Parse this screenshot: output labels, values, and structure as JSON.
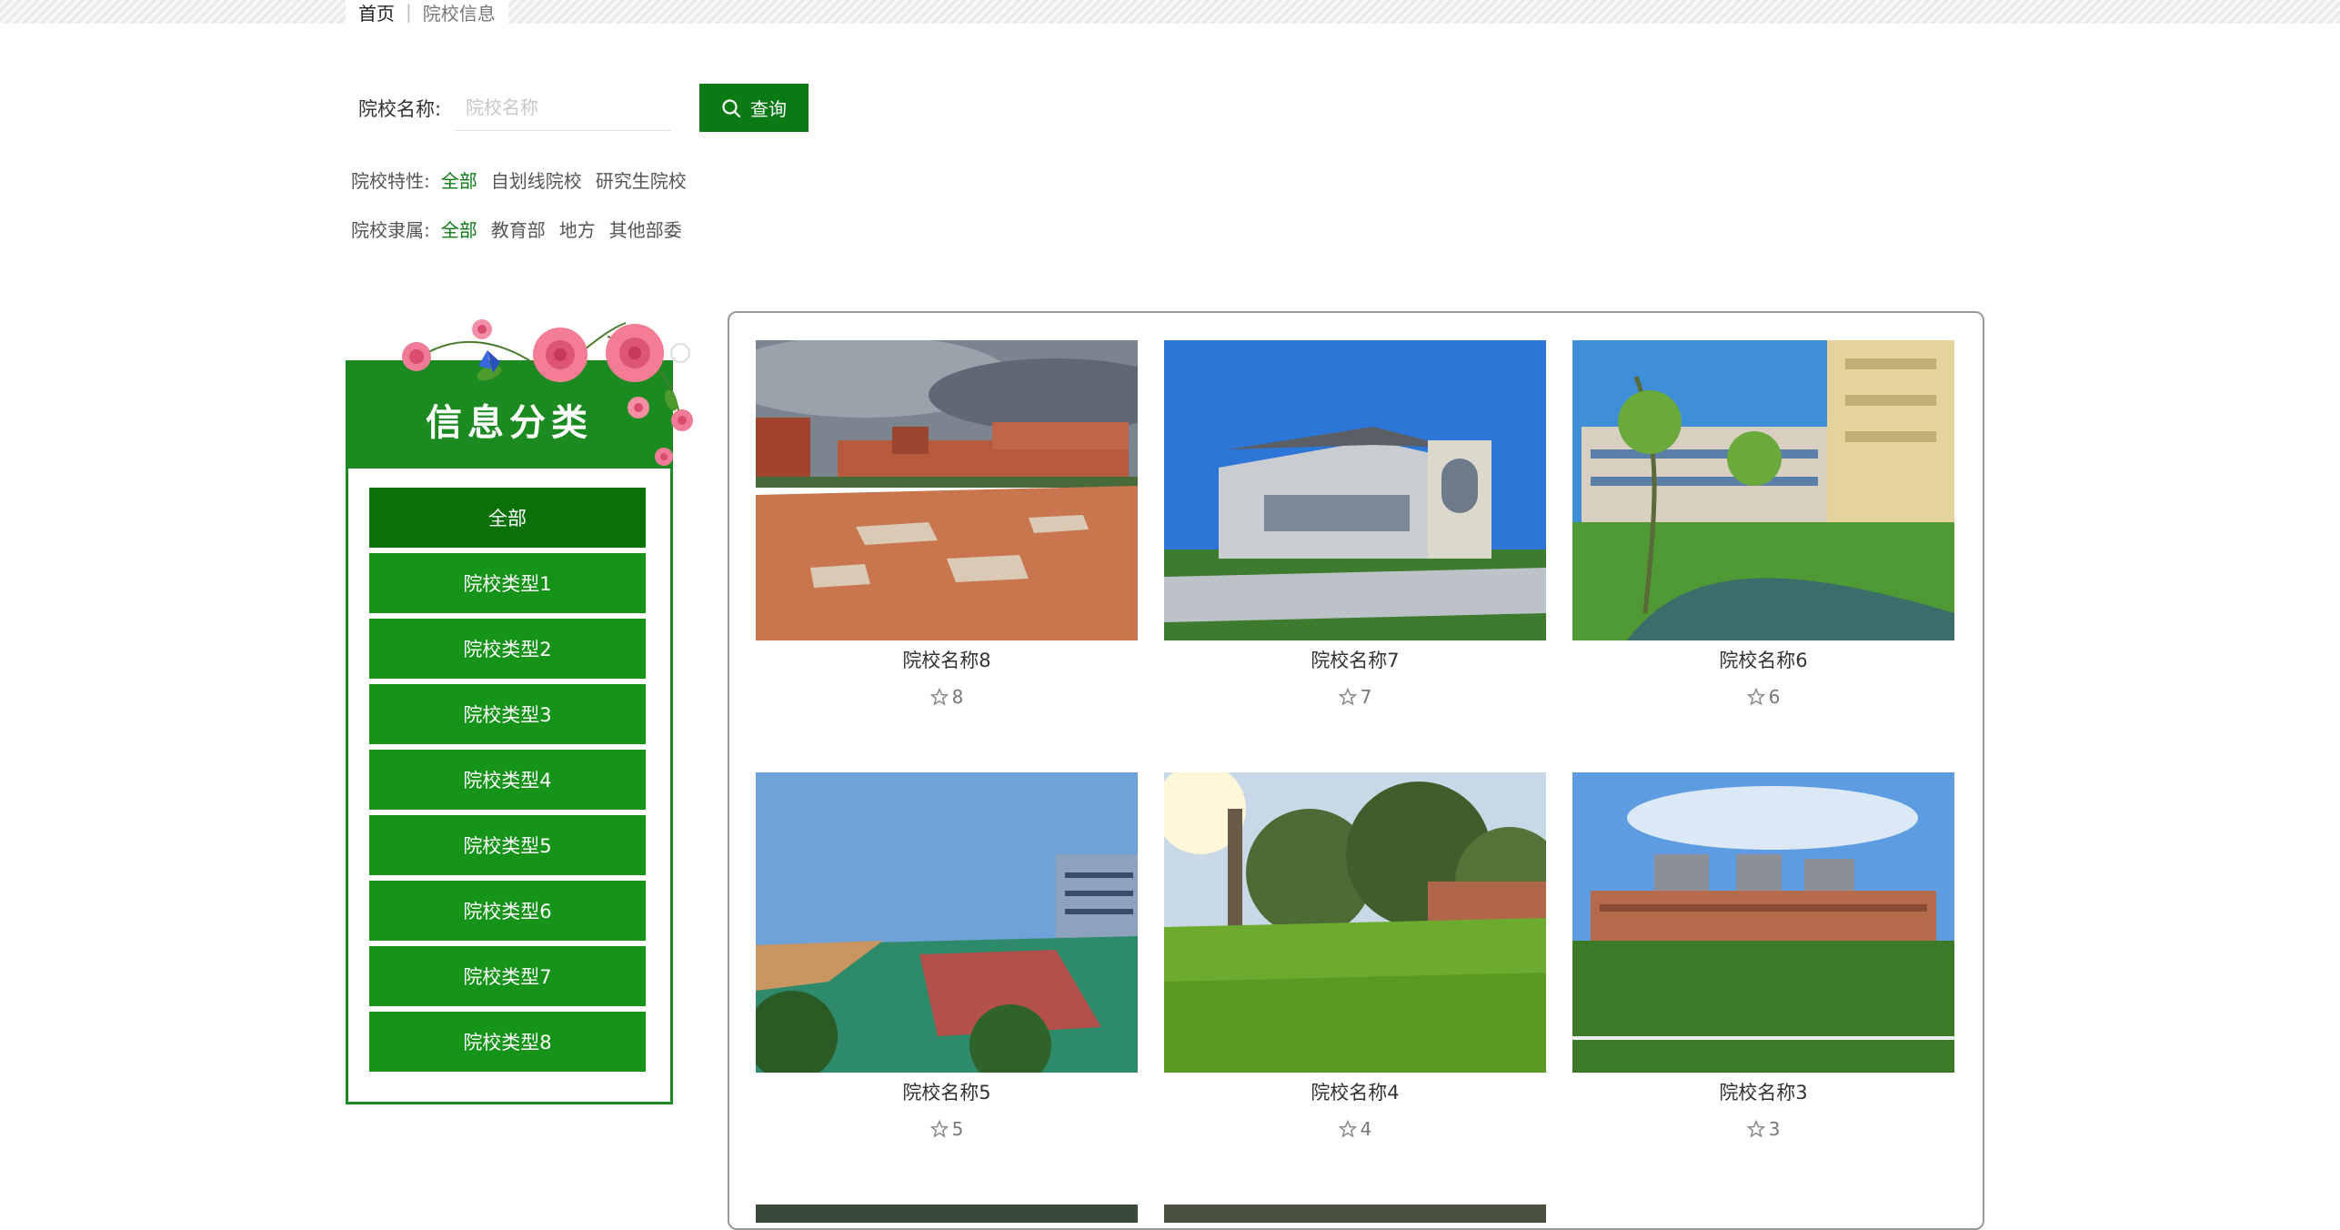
{
  "breadcrumb": {
    "home": "首页",
    "current": "院校信息"
  },
  "search": {
    "label": "院校名称:",
    "placeholder": "院校名称",
    "value": "",
    "button_label": "查询"
  },
  "filters": {
    "feature": {
      "label": "院校特性:",
      "options": [
        "全部",
        "自划线院校",
        "研究生院校"
      ],
      "selected": "全部"
    },
    "affiliation": {
      "label": "院校隶属:",
      "options": [
        "全部",
        "教育部",
        "地方",
        "其他部委"
      ],
      "selected": "全部"
    }
  },
  "sidebar": {
    "title": "信息分类",
    "items": [
      "全部",
      "院校类型1",
      "院校类型2",
      "院校类型3",
      "院校类型4",
      "院校类型5",
      "院校类型6",
      "院校类型7",
      "院校类型8"
    ],
    "active": "全部"
  },
  "cards": [
    {
      "name": "院校名称8",
      "likes": "8"
    },
    {
      "name": "院校名称7",
      "likes": "7"
    },
    {
      "name": "院校名称6",
      "likes": "6"
    },
    {
      "name": "院校名称5",
      "likes": "5"
    },
    {
      "name": "院校名称4",
      "likes": "4"
    },
    {
      "name": "院校名称3",
      "likes": "3"
    }
  ],
  "colors": {
    "accent": "#0b7a14",
    "menu": "#169419",
    "menu_active": "#0a7109",
    "border": "#1a8a21"
  }
}
